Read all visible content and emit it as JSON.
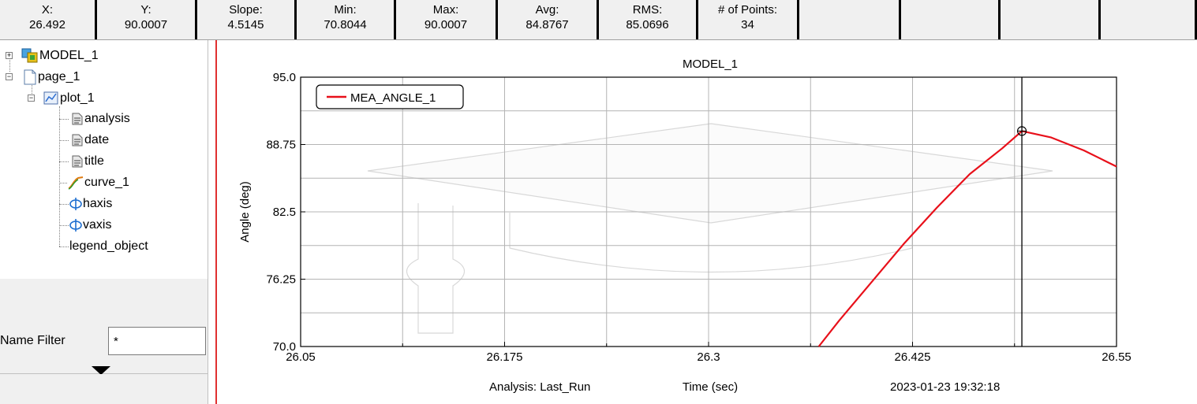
{
  "stats": [
    {
      "label": "X:",
      "value": "26.492"
    },
    {
      "label": "Y:",
      "value": "90.0007"
    },
    {
      "label": "Slope:",
      "value": "4.5145"
    },
    {
      "label": "Min:",
      "value": "70.8044"
    },
    {
      "label": "Max:",
      "value": "90.0007"
    },
    {
      "label": "Avg:",
      "value": "84.8767"
    },
    {
      "label": "RMS:",
      "value": "85.0696"
    },
    {
      "label": "# of Points:",
      "value": "34"
    }
  ],
  "tree": {
    "model": "MODEL_1",
    "page": "page_1",
    "plot": "plot_1",
    "children": [
      "analysis",
      "date",
      "title",
      "curve_1",
      "haxis",
      "vaxis",
      "legend_object"
    ]
  },
  "filter": {
    "label": "Name Filter",
    "value": "*"
  },
  "colors": {
    "curve": "#e8101a",
    "grid": "#b4b4b4",
    "toolbar": "#f0f0f0"
  },
  "chart_data": {
    "type": "line",
    "title": "MODEL_1",
    "xlabel": "Time (sec)",
    "ylabel": "Angle (deg)",
    "xlim": [
      26.05,
      26.55
    ],
    "ylim": [
      70.0,
      95.0
    ],
    "xticks": [
      "26.05",
      "26.175",
      "26.3",
      "26.425",
      "26.55"
    ],
    "yticks": [
      "95.0",
      "88.75",
      "82.5",
      "76.25",
      "70.0"
    ],
    "grid": true,
    "legend_position": "top-left",
    "footer": {
      "analysis": "Analysis:  Last_Run",
      "date": "2023-01-23 19:32:18"
    },
    "cursor": {
      "x": 26.492,
      "y": 90.0007
    },
    "series": [
      {
        "name": "MEA_ANGLE_1",
        "x": [
          26.3675,
          26.38,
          26.4,
          26.42,
          26.44,
          26.46,
          26.48,
          26.492,
          26.51,
          26.53,
          26.55
        ],
        "y": [
          70.0,
          72.4,
          76.0,
          79.6,
          82.9,
          86.0,
          88.4,
          90.0007,
          89.4,
          88.2,
          86.7
        ]
      }
    ]
  }
}
